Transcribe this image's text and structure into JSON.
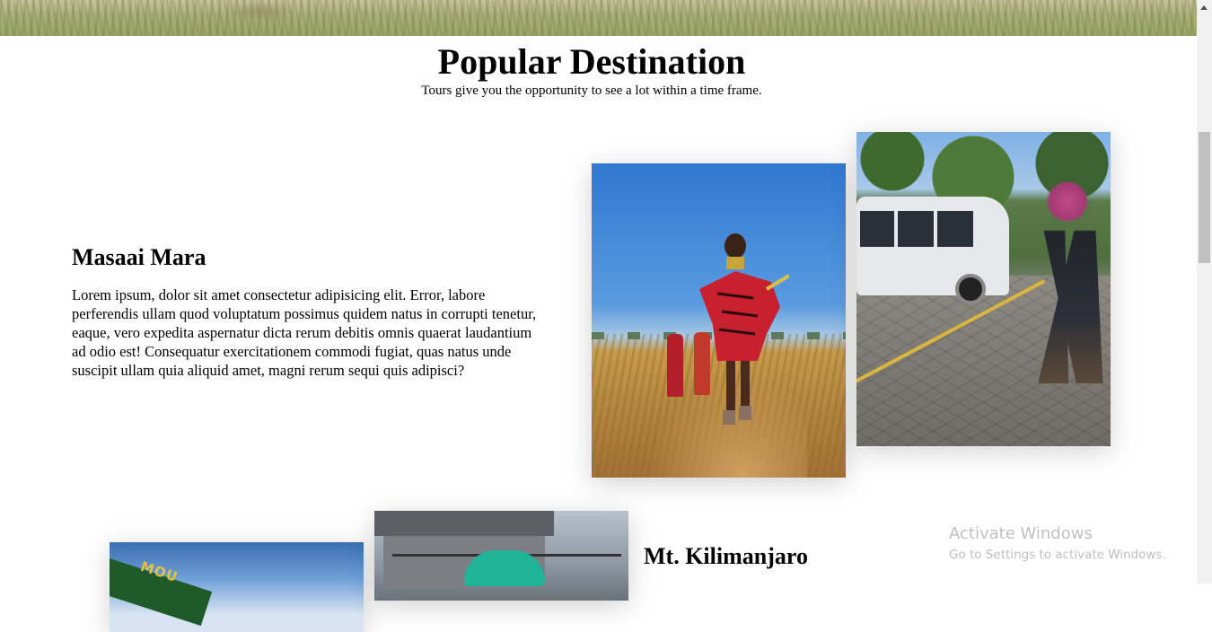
{
  "section": {
    "title": "Popular Destination",
    "subtitle": "Tours give you the opportunity to see a lot within a time frame."
  },
  "destinations": [
    {
      "name": "Masaai Mara",
      "description": "Lorem ipsum, dolor sit amet consectetur adipisicing elit. Error, labore perferendis ullam quod voluptatum possimus quidem natus in corrupti tenetur, eaque, vero expedita aspernatur dicta rerum debitis omnis quaerat laudantium ad odio est! Consequatur exercitationem commodi fugiat, quas natus unde suscipit ullam quia aliquid amet, magni rerum sequi quis adipisci?",
      "photos": [
        "maasai-warrior-photo",
        "tour-van-photo"
      ]
    },
    {
      "name": "Mt. Kilimanjaro",
      "photo_sign_text": "MOU",
      "photos": [
        "kilimanjaro-sign-photo",
        "kilimanjaro-hut-photo"
      ]
    }
  ],
  "watermark": {
    "title": "Activate Windows",
    "subtitle": "Go to Settings to activate Windows."
  },
  "colors": {
    "text": "#000000",
    "background": "#ffffff",
    "watermark": "#bfbfbf",
    "scrollbar_track": "#f1f1f1",
    "scrollbar_thumb": "#c1c1c1"
  }
}
